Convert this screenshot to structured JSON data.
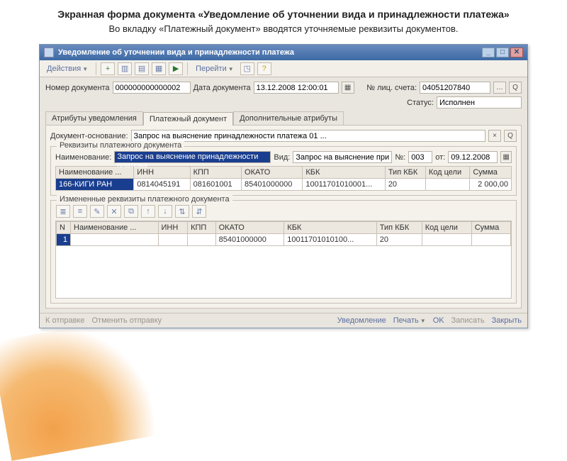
{
  "slide": {
    "title": "Экранная форма документа «Уведомление об уточнении вида и принадлежности платежа»",
    "subtitle": "Во вкладку «Платежный документ»  вводятся уточняемые реквизиты документов."
  },
  "window": {
    "title": "Уведомление об уточнении вида и принадлежности платежа"
  },
  "menu": {
    "actions": "Действия",
    "goto": "Перейти"
  },
  "form": {
    "doc_no_lbl": "Номер документа",
    "doc_no": "000000000000002",
    "doc_date_lbl": "Дата документа",
    "doc_date": "13.12.2008 12:00:01",
    "acct_lbl": "№ лиц. счета:",
    "acct": "04051207840",
    "status_lbl": "Статус:",
    "status": "Исполнен"
  },
  "tabs": {
    "t1": "Атрибуты уведомления",
    "t2": "Платежный документ",
    "t3": "Дополнительные атрибуты"
  },
  "basis": {
    "lbl": "Документ-основание:",
    "val": "Запрос на выяснение принадлежности платежа 01 ..."
  },
  "req": {
    "group": "Реквизиты платежного документа",
    "name_lbl": "Наименование:",
    "name_val": "Запрос на выяснение принадлежности платежа",
    "vid_lbl": "Вид:",
    "vid_val": "Запрос на выяснение при...",
    "num_lbl": "№:",
    "num_val": "003",
    "ot_lbl": "от:",
    "ot_val": "09.12.2008"
  },
  "grid1": {
    "cols": [
      "Наименование ...",
      "ИНН",
      "КПП",
      "ОКАТО",
      "КБК",
      "Тип КБК",
      "Код цели",
      "Сумма"
    ],
    "row": {
      "name": "166-КИГИ РАН",
      "inn": "0814045191",
      "kpp": "081601001",
      "okato": "85401000000",
      "kbk": "10011701010001...",
      "tip": "20",
      "kod": "",
      "summa": "2 000,00"
    }
  },
  "changed": {
    "group": "Измененные реквизиты платежного документа"
  },
  "grid2": {
    "cols": [
      "N",
      "Наименование ...",
      "ИНН",
      "КПП",
      "ОКАТО",
      "КБК",
      "Тип КБК",
      "Код цели",
      "Сумма"
    ],
    "row": {
      "n": "1",
      "name": "",
      "inn": "",
      "kpp": "",
      "okato": "85401000000",
      "kbk": "10011701010100...",
      "tip": "20",
      "kod": "",
      "summa": ""
    }
  },
  "status": {
    "send": "К отправке",
    "cancel": "Отменить отправку",
    "notif": "Уведомление",
    "print": "Печать",
    "ok": "OK",
    "save": "Записать",
    "close": "Закрыть"
  }
}
